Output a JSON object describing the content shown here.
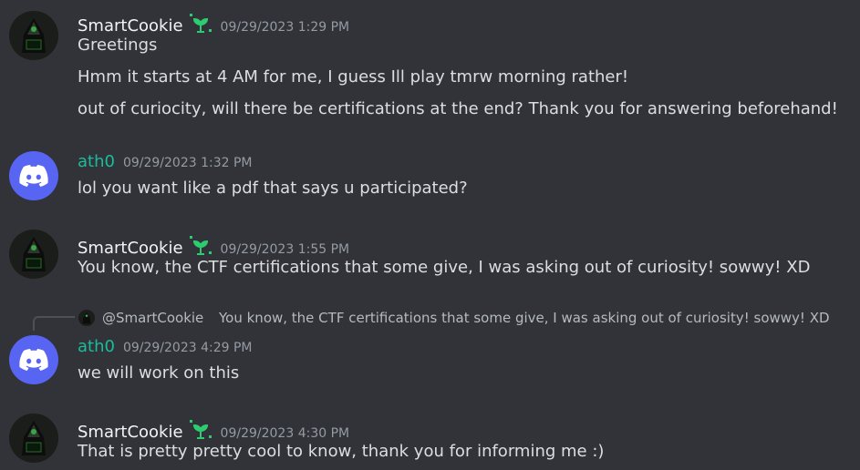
{
  "colors": {
    "background": "#313338",
    "text": "#dbdee1",
    "timestamp": "#949ba4",
    "ath0_name": "#1abc9c",
    "badge": "#2ecc71",
    "discord_blurple": "#5865f2"
  },
  "messages": [
    {
      "author": "SmartCookie",
      "timestamp": "09/29/2023 1:29 PM",
      "badge_icon": "sprout-icon",
      "avatar": "hooded-hacker-avatar",
      "lines": [
        "Greetings",
        "Hmm it starts at 4 AM for me, I guess Ill play tmrw morning rather!",
        "out of curiocity, will there be certifications at the end? Thank you for answering beforehand!"
      ]
    },
    {
      "author": "ath0",
      "timestamp": "09/29/2023 1:32 PM",
      "avatar": "discord-logo-avatar",
      "lines": [
        "lol you want like a pdf that says u participated?"
      ]
    },
    {
      "author": "SmartCookie",
      "timestamp": "09/29/2023 1:55 PM",
      "badge_icon": "sprout-icon",
      "avatar": "hooded-hacker-avatar",
      "lines": [
        "You know, the CTF certifications that some give, I was asking out of curiosity! sowwy! XD"
      ]
    },
    {
      "author": "ath0",
      "timestamp": "09/29/2023 4:29 PM",
      "avatar": "discord-logo-avatar",
      "reply_to": {
        "author": "@SmartCookie",
        "text": "You know, the CTF certifications that some give, I was asking out of curiosity! sowwy! XD"
      },
      "lines": [
        "we will work on this"
      ]
    },
    {
      "author": "SmartCookie",
      "timestamp": "09/29/2023 4:30 PM",
      "badge_icon": "sprout-icon",
      "avatar": "hooded-hacker-avatar",
      "lines": [
        "That is pretty pretty cool to know, thank you for informing me :)"
      ]
    }
  ]
}
